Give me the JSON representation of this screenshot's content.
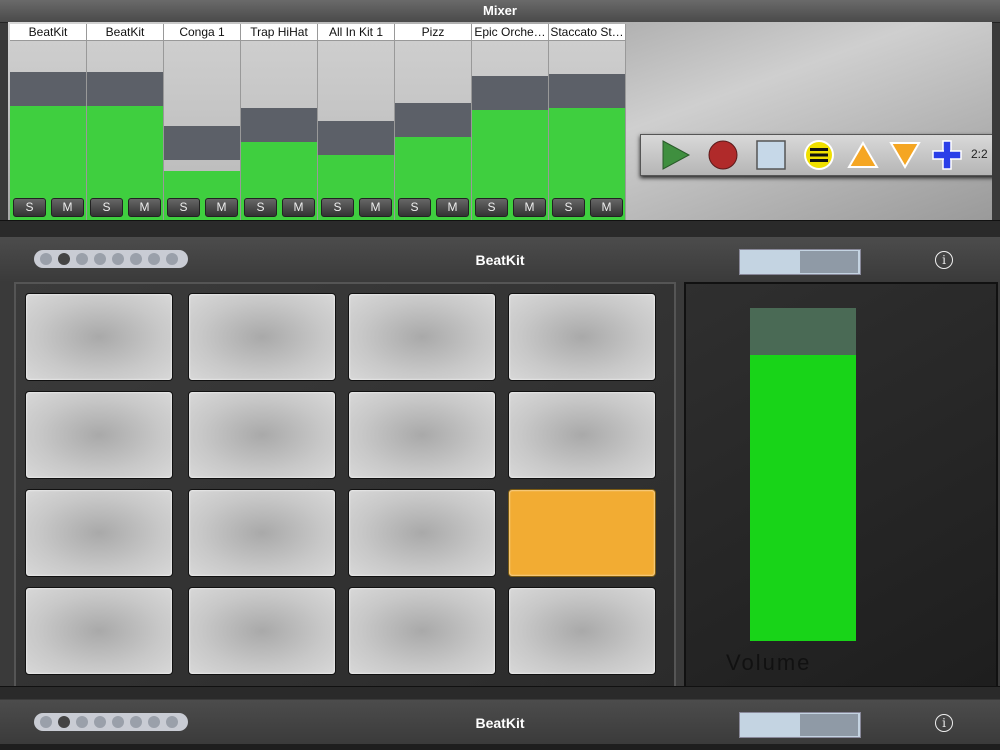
{
  "mixer": {
    "title": "Mixer",
    "channels": [
      {
        "name": "BeatKit",
        "level": 0.82,
        "peak": 0.82,
        "solo": "S",
        "mute": "M"
      },
      {
        "name": "BeatKit",
        "level": 0.82,
        "peak": 0.82,
        "solo": "S",
        "mute": "M"
      },
      {
        "name": "Conga 1",
        "level": 0.27,
        "peak": 0.52,
        "solo": "S",
        "mute": "M"
      },
      {
        "name": "Trap HiHat",
        "level": 0.46,
        "peak": 0.62,
        "solo": "S",
        "mute": "M"
      },
      {
        "name": "All In Kit 1",
        "level": 0.39,
        "peak": 0.55,
        "solo": "S",
        "mute": "M"
      },
      {
        "name": "Pizz",
        "level": 0.49,
        "peak": 0.65,
        "solo": "S",
        "mute": "M"
      },
      {
        "name": "Epic Orche…",
        "level": 0.64,
        "peak": 0.8,
        "solo": "S",
        "mute": "M"
      },
      {
        "name": "Staccato St…",
        "level": 0.65,
        "peak": 0.81,
        "solo": "S",
        "mute": "M"
      }
    ]
  },
  "transport": {
    "play_icon": "play-icon",
    "record_icon": "record-icon",
    "stop_icon": "stop-icon",
    "menu_icon": "menu-icon",
    "up_icon": "arrow-up-icon",
    "down_icon": "arrow-down-icon",
    "add_icon": "add-icon",
    "bar_position": "2:2",
    "colors": {
      "play": "#3f8f3f",
      "record": "#b02a2a",
      "stop": "#c6d8e8",
      "menu": "#f0e000",
      "up": "#f5a623",
      "add": "#2a3ee8"
    }
  },
  "instrument": {
    "title": "BeatKit",
    "info_label": "i",
    "page_dots": 8,
    "active_dot": 1,
    "slider_value": 0.5,
    "volume_label": "Volume",
    "volume_level": 0.86,
    "volume_peak": 1.0,
    "pads": [
      false,
      false,
      false,
      false,
      false,
      false,
      false,
      false,
      false,
      false,
      false,
      true,
      false,
      false,
      false,
      false
    ],
    "pad_active_color": "#f2ac33"
  },
  "lower_instrument": {
    "title": "BeatKit",
    "info_label": "i",
    "page_dots": 8,
    "active_dot": 1,
    "slider_value": 0.5
  }
}
